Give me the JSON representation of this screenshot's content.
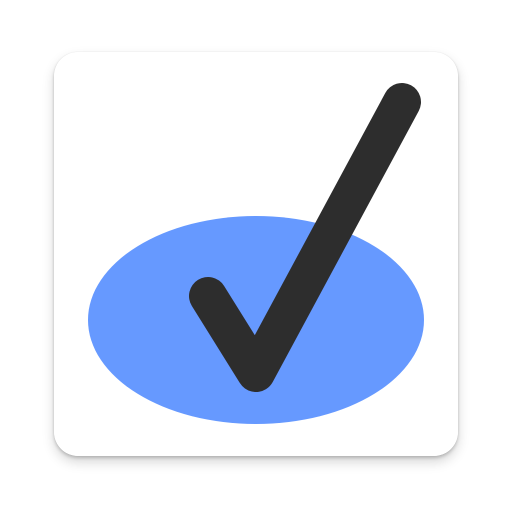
{
  "icon": {
    "tile_color": "#ffffff",
    "ellipse_color": "#6699ff",
    "check_color": "#2d2d2d",
    "icon_names": [
      "app-icon-tile",
      "blue-ellipse-shape",
      "checkmark-icon"
    ]
  }
}
